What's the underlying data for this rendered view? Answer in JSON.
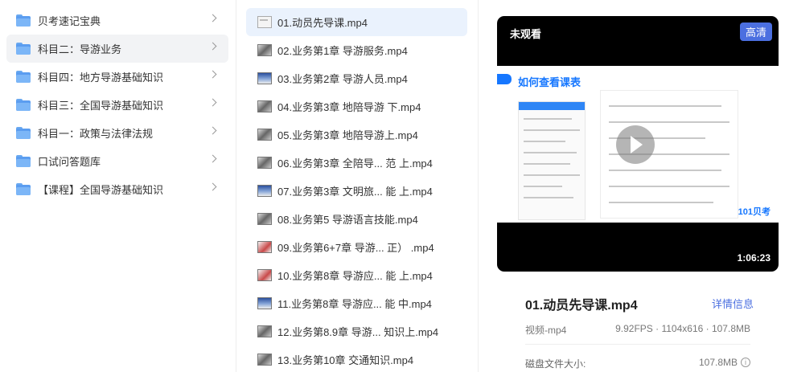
{
  "folders": [
    {
      "label": "贝考速记宝典",
      "active": false
    },
    {
      "label": "科目二：导游业务",
      "active": true
    },
    {
      "label": "科目四：地方导游基础知识",
      "active": false
    },
    {
      "label": "科目三：全国导游基础知识",
      "active": false
    },
    {
      "label": "科目一：政策与法律法规",
      "active": false
    },
    {
      "label": "口试问答题库",
      "active": false
    },
    {
      "label": "【课程】全国导游基础知识",
      "active": false
    }
  ],
  "files": [
    {
      "label": "01.动员先导课.mp4",
      "active": true
    },
    {
      "label": "02.业务第1章 导游服务.mp4",
      "active": false
    },
    {
      "label": "03.业务第2章 导游人员.mp4",
      "active": false
    },
    {
      "label": "04.业务第3章 地陪导游 下.mp4",
      "active": false
    },
    {
      "label": "05.业务第3章 地陪导游上.mp4",
      "active": false
    },
    {
      "label": "06.业务第3章 全陪导... 范 上.mp4",
      "active": false
    },
    {
      "label": "07.业务第3章 文明旅... 能 上.mp4",
      "active": false
    },
    {
      "label": "08.业务第5 导游语言技能.mp4",
      "active": false
    },
    {
      "label": "09.业务第6+7章 导游... 正） .mp4",
      "active": false
    },
    {
      "label": "10.业务第8章 导游应... 能 上.mp4",
      "active": false
    },
    {
      "label": "11.业务第8章 导游应... 能 中.mp4",
      "active": false
    },
    {
      "label": "12.业务第8.9章 导游... 知识上.mp4",
      "active": false
    },
    {
      "label": "13.业务第10章 交通知识.mp4",
      "active": false
    }
  ],
  "preview": {
    "status": "未观看",
    "quality": "高清",
    "duration": "1:06:23",
    "frame_title": "如何查看课表",
    "frame_brand": "101贝考"
  },
  "info": {
    "title": "01.动员先导课.mp4",
    "detail_link": "详情信息",
    "type": "视频-mp4",
    "specs": "9.92FPS · 1104x616 · 107.8MB",
    "size_label": "磁盘文件大小:",
    "size_value": "107.8MB"
  }
}
